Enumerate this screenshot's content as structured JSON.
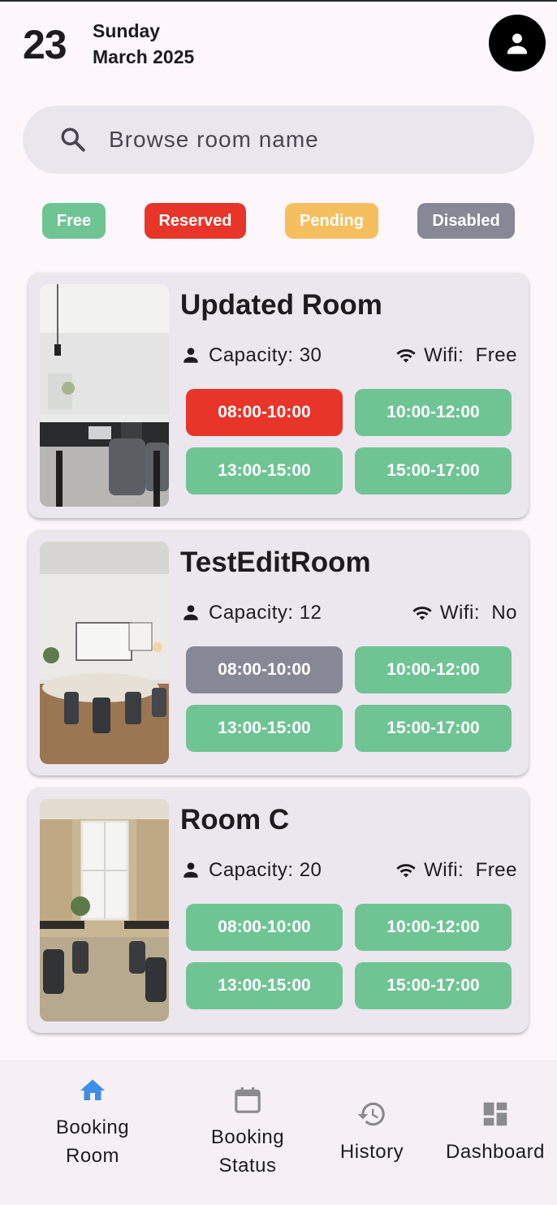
{
  "header": {
    "day_number": "23",
    "weekday": "Sunday",
    "month_year": "March 2025"
  },
  "search": {
    "placeholder": "Browse room name"
  },
  "legend": [
    {
      "label": "Free",
      "color": "#6fc494"
    },
    {
      "label": "Reserved",
      "color": "#e7352a"
    },
    {
      "label": "Pending",
      "color": "#f5bf60"
    },
    {
      "label": "Disabled",
      "color": "#878896"
    }
  ],
  "status_colors": {
    "free": "#6fc494",
    "reserved": "#e7352a",
    "pending": "#f5bf60",
    "disabled": "#878896"
  },
  "rooms": [
    {
      "name": "Updated Room",
      "capacity_text": "Capacity: 30",
      "wifi_text": "Wifi:  Free",
      "slots": [
        {
          "time": "08:00-10:00",
          "status": "reserved"
        },
        {
          "time": "10:00-12:00",
          "status": "free"
        },
        {
          "time": "13:00-15:00",
          "status": "free"
        },
        {
          "time": "15:00-17:00",
          "status": "free"
        }
      ]
    },
    {
      "name": "TestEditRoom",
      "capacity_text": "Capacity: 12",
      "wifi_text": "Wifi:  No",
      "slots": [
        {
          "time": "08:00-10:00",
          "status": "disabled"
        },
        {
          "time": "10:00-12:00",
          "status": "free"
        },
        {
          "time": "13:00-15:00",
          "status": "free"
        },
        {
          "time": "15:00-17:00",
          "status": "free"
        }
      ]
    },
    {
      "name": "Room C",
      "capacity_text": "Capacity: 20",
      "wifi_text": "Wifi:  Free",
      "slots": [
        {
          "time": "08:00-10:00",
          "status": "free"
        },
        {
          "time": "10:00-12:00",
          "status": "free"
        },
        {
          "time": "13:00-15:00",
          "status": "free"
        },
        {
          "time": "15:00-17:00",
          "status": "free"
        }
      ]
    }
  ],
  "nav": {
    "active_color": "#3e8ee8",
    "inactive_color": "#8c8a8f",
    "items": [
      {
        "line1": "Booking",
        "line2": "Room",
        "icon": "home-icon",
        "active": true
      },
      {
        "line1": "Booking",
        "line2": "Status",
        "icon": "calendar-icon",
        "active": false
      },
      {
        "line1": "History",
        "icon": "history-icon",
        "active": false
      },
      {
        "line1": "Dashboard",
        "icon": "dashboard-icon",
        "active": false
      }
    ]
  }
}
